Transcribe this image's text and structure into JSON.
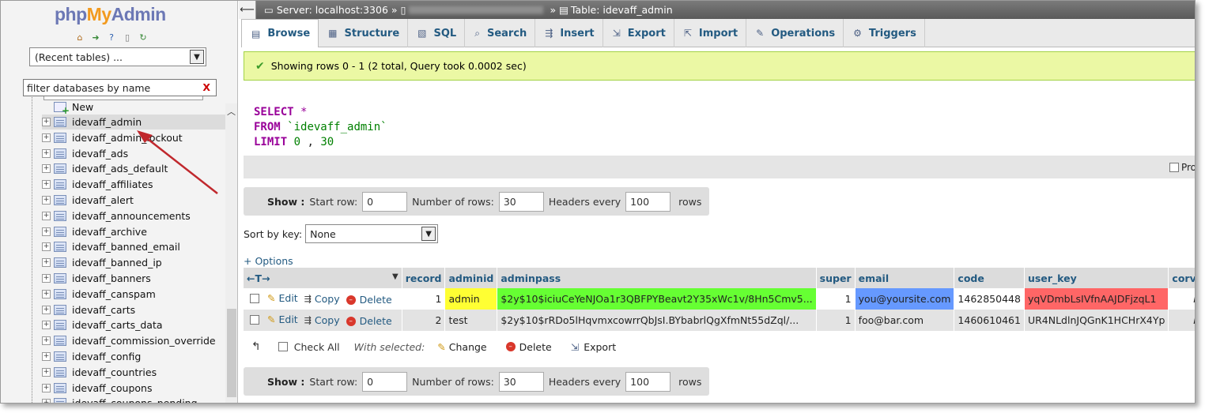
{
  "left": {
    "logo": {
      "php": "php",
      "my": "My",
      "admin": "Admin"
    },
    "quick_icons": [
      "home-icon",
      "logout-icon",
      "help-icon",
      "docs-icon",
      "reload-icon"
    ],
    "recent_tables": "(Recent tables) ...",
    "filter_placeholder": "filter databases by name",
    "filter_clear": "X",
    "new_label": "New",
    "tables": [
      "idevaff_admin",
      "idevaff_admin_lockout",
      "idevaff_ads",
      "idevaff_ads_default",
      "idevaff_affiliates",
      "idevaff_alert",
      "idevaff_announcements",
      "idevaff_archive",
      "idevaff_banned_email",
      "idevaff_banned_ip",
      "idevaff_banners",
      "idevaff_canspam",
      "idevaff_carts",
      "idevaff_carts_data",
      "idevaff_commission_override",
      "idevaff_config",
      "idevaff_countries",
      "idevaff_coupons",
      "idevaff_coupons_pending"
    ],
    "selected_table": "idevaff_admin"
  },
  "breadcrumb": {
    "server": "Server: localhost:3306",
    "sep": "»",
    "table": "Table: idevaff_admin"
  },
  "tabs": [
    {
      "label": "Browse",
      "icon": "browse-icon",
      "glyph": "▤"
    },
    {
      "label": "Structure",
      "icon": "structure-icon",
      "glyph": "▦"
    },
    {
      "label": "SQL",
      "icon": "sql-icon",
      "glyph": "▧"
    },
    {
      "label": "Search",
      "icon": "search-icon",
      "glyph": "⌕"
    },
    {
      "label": "Insert",
      "icon": "insert-icon",
      "glyph": "⇶"
    },
    {
      "label": "Export",
      "icon": "export-icon",
      "glyph": "⇲"
    },
    {
      "label": "Import",
      "icon": "import-icon",
      "glyph": "⇱"
    },
    {
      "label": "Operations",
      "icon": "operations-icon",
      "glyph": "✎"
    },
    {
      "label": "Triggers",
      "icon": "triggers-icon",
      "glyph": "⚙"
    }
  ],
  "message": "Showing rows 0 - 1 (2 total, Query took 0.0002 sec)",
  "sql": {
    "select": "SELECT",
    "star": "*",
    "from": "FROM",
    "table": "`idevaff_admin`",
    "limit": "LIMIT",
    "start": "0",
    "comma": ",",
    "count": "30",
    "profiling": "Pro"
  },
  "nav": {
    "show": "Show :",
    "start_row_label": "Start row:",
    "start_row": "0",
    "num_rows_label": "Number of rows:",
    "num_rows": "30",
    "headers_label": "Headers every",
    "headers": "100",
    "rows": "rows"
  },
  "sort": {
    "label": "Sort by key:",
    "value": "None"
  },
  "options_link": "+ Options",
  "columns": [
    "record",
    "adminid",
    "adminpass",
    "super",
    "email",
    "code",
    "user_key",
    "corvette"
  ],
  "col_controls": "←T→",
  "row_actions": {
    "edit": "Edit",
    "copy": "Copy",
    "delete": "Delete"
  },
  "rows": [
    {
      "record": "1",
      "adminid": "admin",
      "adminpass": "$2y$10$iciuCeYeNJOa1r3QBFPYBeavt2Y35xWc1v/8Hn5Cmv5...",
      "super": "1",
      "email": "you@yoursite.com",
      "code": "1462850448",
      "user_key": "yqVDmbLsIVfnAAJDFjzqL1",
      "corvette": "NULL"
    },
    {
      "record": "2",
      "adminid": "test",
      "adminpass": "$2y$10$rRDo5lHqvmxcowrrQbJsI.BYbabrlQgXfmNt55dZql/...",
      "super": "1",
      "email": "foo@bar.com",
      "code": "1460610461",
      "user_key": "UR4NLdlnJQGnK1HCHrX4Yp",
      "corvette": "NULL"
    }
  ],
  "highlight_colors": {
    "adminid": "#ffff33",
    "adminpass": "#66ff33",
    "email": "#6699ff",
    "user_key": "#ff6666"
  },
  "with_selected": {
    "check_all": "Check All",
    "label": "With selected:",
    "change": "Change",
    "delete": "Delete",
    "export": "Export"
  }
}
